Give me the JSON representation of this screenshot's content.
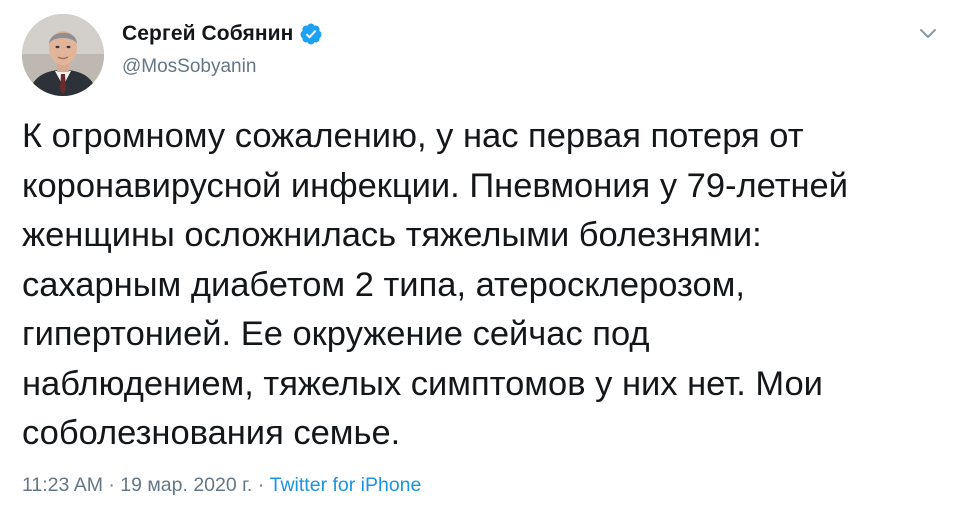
{
  "author": {
    "display_name": "Сергей Собянин",
    "handle": "@MosSobyanin",
    "verified": true
  },
  "tweet": {
    "text": "К огромному сожалению, у нас первая потеря от\nкоронавирусной инфекции. Пневмония у 79-летней\nженщины осложнилась тяжелыми болезнями:\nсахарным диабетом 2 типа, атеросклерозом,\nгипертонией. Ее окружение сейчас под\nнаблюдением, тяжелых симптомов у них нет. Мои\nсоболезнования семье."
  },
  "meta": {
    "time": "11:23 AM",
    "separator": "·",
    "date": "19 мар. 2020 г.",
    "source": "Twitter for iPhone"
  },
  "icons": {
    "verified": "verified-badge-icon",
    "caret": "chevron-down-icon"
  },
  "colors": {
    "accent": "#1da1f2",
    "link": "#1b95e0",
    "secondary_text": "#657786",
    "primary_text": "#14171a"
  }
}
